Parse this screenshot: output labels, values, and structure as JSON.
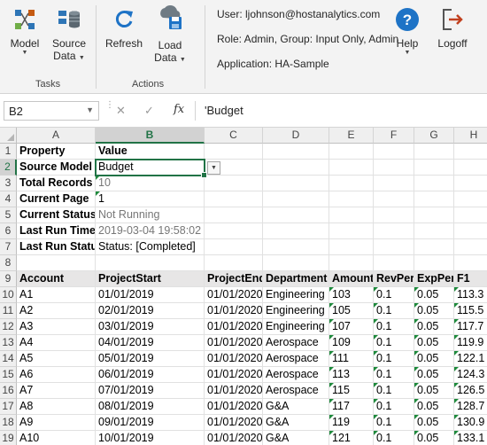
{
  "ribbon": {
    "tasks": {
      "label": "Tasks",
      "model": "Model",
      "source_data_line1": "Source",
      "source_data_line2": "Data"
    },
    "actions": {
      "label": "Actions",
      "refresh": "Refresh",
      "load_data_line1": "Load",
      "load_data_line2": "Data"
    },
    "user_text": "User: ljohnson@hostanalytics.com",
    "role_text": "Role: Admin, Group: Input Only, Admin",
    "application_text": "Application: HA-Sample",
    "help": "Help",
    "logoff": "Logoff",
    "dropdown_glyph": "▼"
  },
  "formula_bar": {
    "name_box": "B2",
    "cancel_symbol": "✕",
    "enter_symbol": "✓",
    "fx_symbol": "fx",
    "formula": "'Budget"
  },
  "columns": [
    "A",
    "B",
    "C",
    "D",
    "E",
    "F",
    "G",
    "H"
  ],
  "rows": [
    "1",
    "2",
    "3",
    "4",
    "5",
    "6",
    "7",
    "8",
    "9",
    "10",
    "11",
    "12",
    "13",
    "14",
    "15",
    "16",
    "17",
    "18",
    "19"
  ],
  "properties": [
    {
      "property": "Property",
      "value": "Value"
    },
    {
      "property": "Source Model",
      "value": "Budget"
    },
    {
      "property": "Total Records",
      "value": "10"
    },
    {
      "property": "Current Page",
      "value": "1"
    },
    {
      "property": "Current Status",
      "value": "Not Running"
    },
    {
      "property": "Last Run Time",
      "value": "2019-03-04 19:58:02"
    },
    {
      "property": "Last Run Status",
      "value": "Status: [Completed]"
    }
  ],
  "data_table": {
    "headers": [
      "Account",
      "ProjectStart",
      "ProjectEnd",
      "Department",
      "Amount",
      "RevPer",
      "ExpPer",
      "F1"
    ],
    "rows": [
      [
        "A1",
        "01/01/2019",
        "01/01/2020",
        "Engineering",
        "103",
        "0.1",
        "0.05",
        "113.3"
      ],
      [
        "A2",
        "02/01/2019",
        "01/01/2020",
        "Engineering",
        "105",
        "0.1",
        "0.05",
        "115.5"
      ],
      [
        "A3",
        "03/01/2019",
        "01/01/2020",
        "Engineering",
        "107",
        "0.1",
        "0.05",
        "117.7"
      ],
      [
        "A4",
        "04/01/2019",
        "01/01/2020",
        "Aerospace",
        "109",
        "0.1",
        "0.05",
        "119.9"
      ],
      [
        "A5",
        "05/01/2019",
        "01/01/2020",
        "Aerospace",
        "111",
        "0.1",
        "0.05",
        "122.1"
      ],
      [
        "A6",
        "06/01/2019",
        "01/01/2020",
        "Aerospace",
        "113",
        "0.1",
        "0.05",
        "124.3"
      ],
      [
        "A7",
        "07/01/2019",
        "01/01/2020",
        "Aerospace",
        "115",
        "0.1",
        "0.05",
        "126.5"
      ],
      [
        "A8",
        "08/01/2019",
        "01/01/2020",
        "G&A",
        "117",
        "0.1",
        "0.05",
        "128.7"
      ],
      [
        "A9",
        "09/01/2019",
        "01/01/2020",
        "G&A",
        "119",
        "0.1",
        "0.05",
        "130.9"
      ],
      [
        "A10",
        "10/01/2019",
        "01/01/2020",
        "G&A",
        "121",
        "0.1",
        "0.05",
        "133.1"
      ]
    ]
  },
  "colors": {
    "excel_green": "#217346",
    "ribbon_bg": "#f3f3f3",
    "help_blue": "#1e73c6",
    "logoff_red": "#c1401f"
  }
}
